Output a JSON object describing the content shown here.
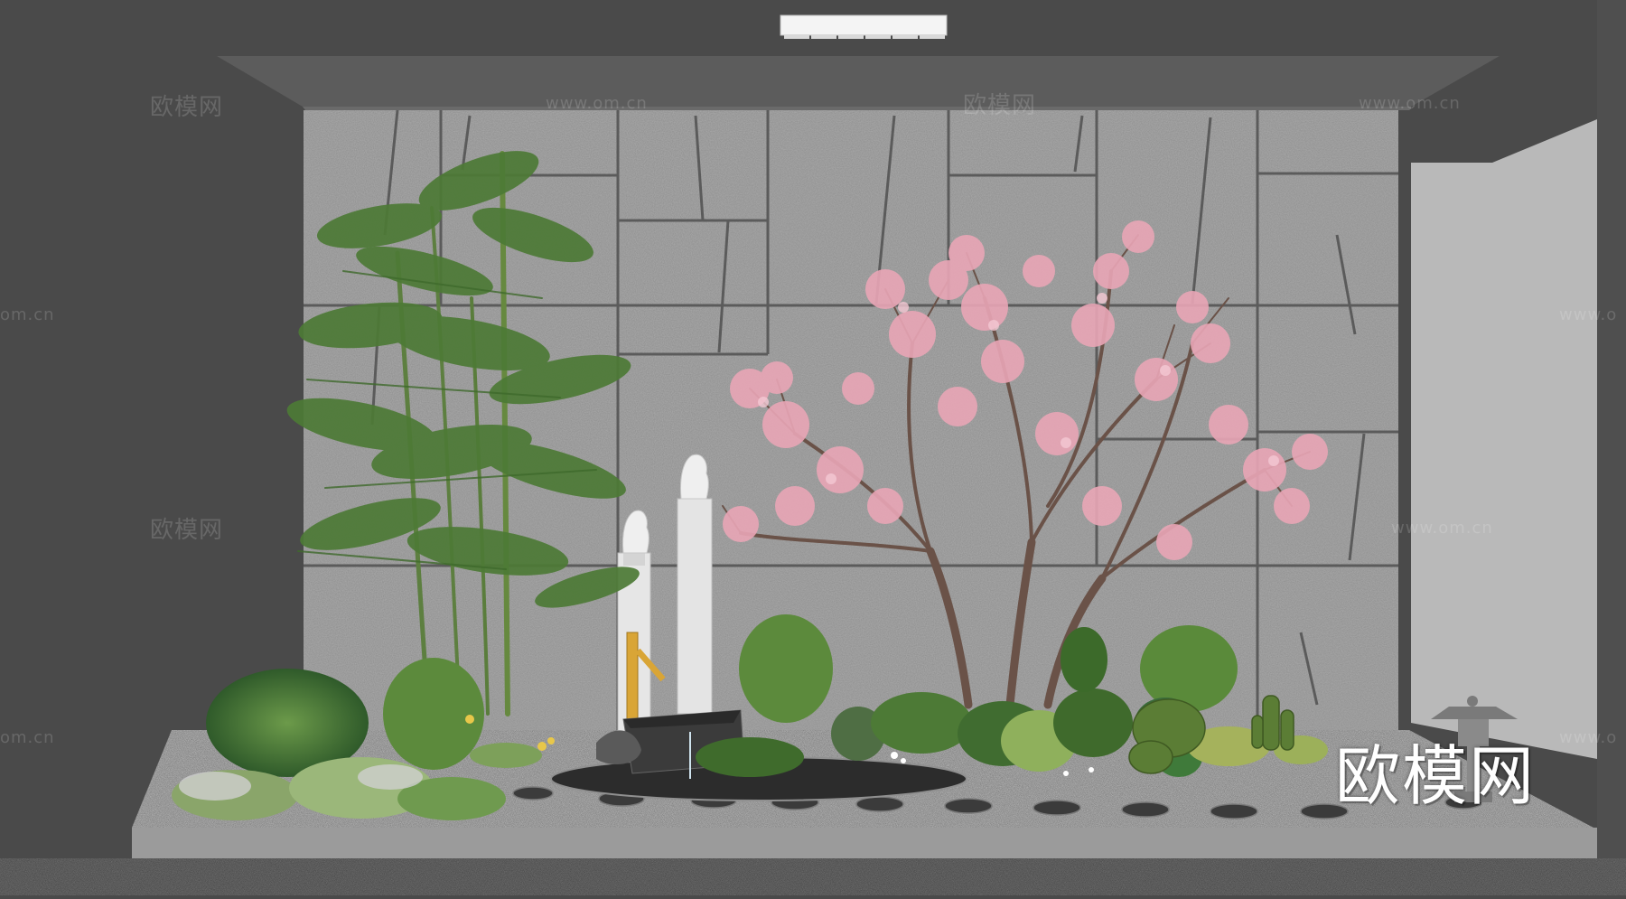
{
  "watermarks": {
    "logo_cn": "欧模网",
    "site": "www.om.cn",
    "site_left_cut": "om.cn",
    "site_right_cut": "www.o",
    "site_partial": "www.om.cn"
  },
  "logo": {
    "text": "欧模网"
  },
  "colors": {
    "room": "#4a4a4a",
    "wall_stone": "#8a8a8a",
    "stone_joint": "#5a5a5a",
    "blossom": "#e9a6b6",
    "bamboo_leaf": "#4f7a3a",
    "side_panel": "#b9b9b9"
  },
  "icons": [
    "ceiling-light-icon",
    "stone-lantern-icon",
    "lion-statue-icon",
    "bamboo-spout-icon"
  ]
}
